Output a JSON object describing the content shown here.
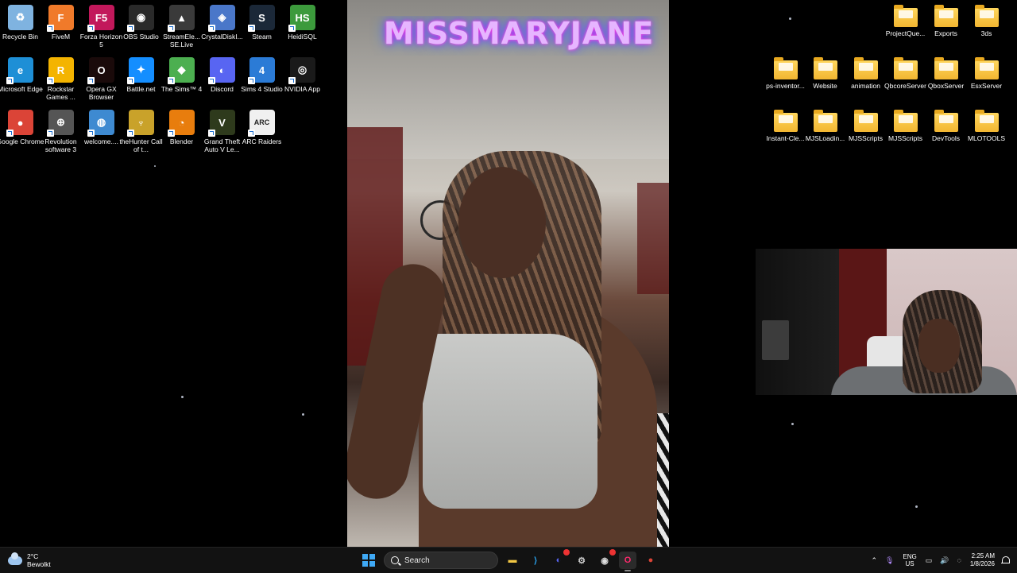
{
  "desktop_icons_left": [
    {
      "label": "Recycle Bin",
      "icon": "recycle-bin-icon",
      "color": "#7fb3e0",
      "glyph": "♻"
    },
    {
      "label": "FiveM",
      "icon": "fivem-icon",
      "color": "#f07a2a",
      "glyph": "F"
    },
    {
      "label": "Forza Horizon 5",
      "icon": "forza-icon",
      "color": "#c2185b",
      "glyph": "F5"
    },
    {
      "label": "OBS Studio",
      "icon": "obs-icon",
      "color": "#2a2a2a",
      "glyph": "◉"
    },
    {
      "label": "StreamEle... SE.Live",
      "icon": "streamelements-icon",
      "color": "#3a3a3a",
      "glyph": "▲"
    },
    {
      "label": "CrystalDiskI...",
      "icon": "crystaldisk-icon",
      "color": "#4a77c9",
      "glyph": "◈"
    },
    {
      "label": "Steam",
      "icon": "steam-icon",
      "color": "#1b2838",
      "glyph": "S"
    },
    {
      "label": "HeidiSQL",
      "icon": "heidisql-icon",
      "color": "#3c9a3c",
      "glyph": "HS"
    },
    {
      "label": "Microsoft Edge",
      "icon": "edge-icon",
      "color": "#1e8fd6",
      "glyph": "e"
    },
    {
      "label": "Rockstar Games ...",
      "icon": "rockstar-icon",
      "color": "#f4b400",
      "glyph": "R"
    },
    {
      "label": "Opera GX Browser",
      "icon": "opera-gx-icon",
      "color": "#1a0a0a",
      "glyph": "O"
    },
    {
      "label": "Battle.net",
      "icon": "battlenet-icon",
      "color": "#148eff",
      "glyph": "✦"
    },
    {
      "label": "The Sims™ 4",
      "icon": "sims4-icon",
      "color": "#4caf50",
      "glyph": "◆"
    },
    {
      "label": "Discord",
      "icon": "discord-icon",
      "color": "#5865f2",
      "glyph": "◐"
    },
    {
      "label": "Sims 4 Studio",
      "icon": "sims4studio-icon",
      "color": "#2b7bd6",
      "glyph": "4"
    },
    {
      "label": "NVIDIA App",
      "icon": "nvidia-icon",
      "color": "#1a1a1a",
      "glyph": "◎"
    },
    {
      "label": "Google Chrome",
      "icon": "chrome-icon",
      "color": "#db4437",
      "glyph": "●"
    },
    {
      "label": "Revolution software 3",
      "icon": "revolution-icon",
      "color": "#555",
      "glyph": "⊕"
    },
    {
      "label": "welcome....",
      "icon": "globe-icon",
      "color": "#3e8ad1",
      "glyph": "◍"
    },
    {
      "label": "theHunter Call of t...",
      "icon": "thehunter-icon",
      "color": "#c9a22a",
      "glyph": "♆"
    },
    {
      "label": "Blender",
      "icon": "blender-icon",
      "color": "#e87d0d",
      "glyph": "◔"
    },
    {
      "label": "Grand Theft Auto V Le...",
      "icon": "gta5-icon",
      "color": "#2e3a1c",
      "glyph": "V"
    },
    {
      "label": "ARC Raiders",
      "icon": "arc-raiders-icon",
      "color": "#f0f0f0",
      "glyph": "ARC"
    }
  ],
  "desktop_icons_right": [
    {
      "label": "ProjectQue...",
      "icon": "folder-icon"
    },
    {
      "label": "Exports",
      "icon": "folder-icon"
    },
    {
      "label": "3ds",
      "icon": "folder-icon"
    },
    {
      "label": "ps-inventor...",
      "icon": "folder-icon"
    },
    {
      "label": "Website",
      "icon": "folder-icon"
    },
    {
      "label": "animation",
      "icon": "folder-icon"
    },
    {
      "label": "QbcoreServer",
      "icon": "folder-icon"
    },
    {
      "label": "QboxServer",
      "icon": "folder-icon"
    },
    {
      "label": "EsxServer",
      "icon": "folder-icon"
    },
    {
      "label": "Instant-Cle...",
      "icon": "folder-icon"
    },
    {
      "label": "MJSLoadin...",
      "icon": "folder-icon"
    },
    {
      "label": "MJSScripts",
      "icon": "folder-icon"
    },
    {
      "label": "MJSScripts",
      "icon": "folder-icon"
    },
    {
      "label": "DevTools",
      "icon": "folder-icon"
    },
    {
      "label": "MLOTOOLS",
      "icon": "folder-icon"
    }
  ],
  "wallpaper": {
    "neon_title": "MISSMARYJANE"
  },
  "taskbar": {
    "weather": {
      "temp": "2°C",
      "condition": "Bewolkt"
    },
    "search_label": "Search",
    "pinned_apps": [
      {
        "icon": "file-explorer-icon",
        "color": "#f2c744",
        "glyph": "▬"
      },
      {
        "icon": "vscode-icon",
        "color": "#2aa3ef",
        "glyph": "⟩"
      },
      {
        "icon": "discord-taskbar-icon",
        "color": "#5865f2",
        "glyph": "◐"
      },
      {
        "icon": "settings-icon",
        "color": "#cccccc",
        "glyph": "⚙"
      },
      {
        "icon": "obs-taskbar-icon",
        "color": "#dddddd",
        "glyph": "◉"
      },
      {
        "icon": "opera-gx-taskbar-icon",
        "color": "#ff2a6d",
        "glyph": "O"
      },
      {
        "icon": "chrome-taskbar-icon",
        "color": "#db4437",
        "glyph": "●"
      }
    ],
    "tray": {
      "lang_top": "ENG",
      "lang_bottom": "US",
      "time": "2:25 AM",
      "date": "1/8/2026"
    }
  }
}
